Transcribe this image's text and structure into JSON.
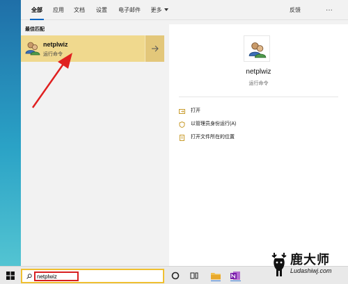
{
  "filter_tabs": [
    {
      "label": "全部",
      "active": true
    },
    {
      "label": "应用",
      "active": false
    },
    {
      "label": "文档",
      "active": false
    },
    {
      "label": "设置",
      "active": false
    },
    {
      "label": "电子邮件",
      "active": false
    },
    {
      "label": "更多",
      "active": false
    }
  ],
  "header": {
    "feedback": "反馈",
    "more_options": "···"
  },
  "results": {
    "section_title": "最佳匹配",
    "best_match": {
      "name": "netplwiz",
      "subtitle": "运行命令",
      "icon": "users-icon"
    }
  },
  "detail": {
    "name": "netplwiz",
    "subtitle": "运行命令",
    "actions": [
      {
        "label": "打开",
        "icon": "open-icon"
      },
      {
        "label": "以管理员身份运行(A)",
        "icon": "run-as-admin-icon"
      },
      {
        "label": "打开文件所在的位置",
        "icon": "folder-location-icon"
      }
    ]
  },
  "search": {
    "value": "netplwiz"
  },
  "taskbar": {
    "icons": [
      "start-icon",
      "search-icon",
      "cortana-icon",
      "task-view-icon",
      "file-explorer-icon",
      "onenote-icon"
    ]
  },
  "watermark": {
    "name": "鹿大师",
    "url": "Ludashiwj.com"
  },
  "colors": {
    "highlight": "#f0d98e",
    "accent": "#0a66c2",
    "annotation": "#d71f1f",
    "searchbox_border": "#f0c030"
  }
}
